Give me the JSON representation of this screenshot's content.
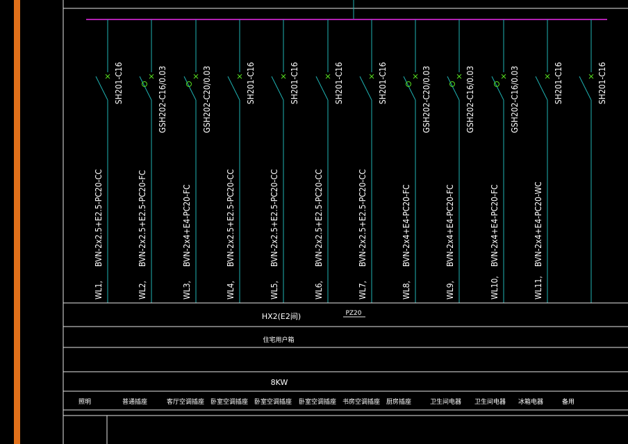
{
  "colors": {
    "background": "#000000",
    "left_margin_bar": "#e0701a",
    "busbar": "#b020b0",
    "circuit_line": "#1fb5b5",
    "breaker_mark": "#58e020",
    "frame_line": "#e8e8e8",
    "text": "#ffffff"
  },
  "circuits": [
    {
      "id": "WL1,",
      "cable": "BVN-2x2.5+E2.5-PC20-CC",
      "breaker": "SH201-C16",
      "rcd": false
    },
    {
      "id": "WL2,",
      "cable": "BVN-2x2.5+E2.5-PC20-FC",
      "breaker": "GSH202-C16/0.03",
      "rcd": true
    },
    {
      "id": "WL3,",
      "cable": "BVN-2x4+E4-PC20-FC",
      "breaker": "GSH202-C20/0.03",
      "rcd": true
    },
    {
      "id": "WL4,",
      "cable": "BVN-2x2.5+E2.5-PC20-CC",
      "breaker": "SH201-C16",
      "rcd": false
    },
    {
      "id": "WL5,",
      "cable": "BVN-2x2.5+E2.5-PC20-CC",
      "breaker": "SH201-C16",
      "rcd": false
    },
    {
      "id": "WL6,",
      "cable": "BVN-2x2.5+E2.5-PC20-CC",
      "breaker": "SH201-C16",
      "rcd": false
    },
    {
      "id": "WL7,",
      "cable": "BVN-2x2.5+E2.5-PC20-CC",
      "breaker": "SH201-C16",
      "rcd": false
    },
    {
      "id": "WL8,",
      "cable": "BVN-2x4+E4-PC20-FC",
      "breaker": "GSH202-C20/0.03",
      "rcd": true
    },
    {
      "id": "WL9,",
      "cable": "BVN-2x4+E4-PC20-FC",
      "breaker": "GSH202-C16/0.03",
      "rcd": true
    },
    {
      "id": "WL10,",
      "cable": "BVN-2x4+E4-PC20-FC",
      "breaker": "GSH202-C16/0.03",
      "rcd": true
    },
    {
      "id": "WL11,",
      "cable": "BVN-2x4+E4-PC20-WC",
      "breaker": "SH201-C16",
      "rcd": false
    },
    {
      "id": "",
      "cable": "",
      "breaker": "SH201-C16",
      "rcd": false
    }
  ],
  "panel": {
    "name": "HX2(E2间)",
    "enclosure": "PZ20",
    "usage": "住宅用户箱",
    "power": "8KW"
  },
  "load_labels": [
    "照明",
    "普通插座",
    "客厅空调插座",
    "卧室空调插座",
    "卧室空调插座",
    "卧室空调插座",
    "书房空调插座",
    "厨房插座",
    "卫生间电器",
    "卫生间电器",
    "冰箱电器",
    "备用"
  ]
}
